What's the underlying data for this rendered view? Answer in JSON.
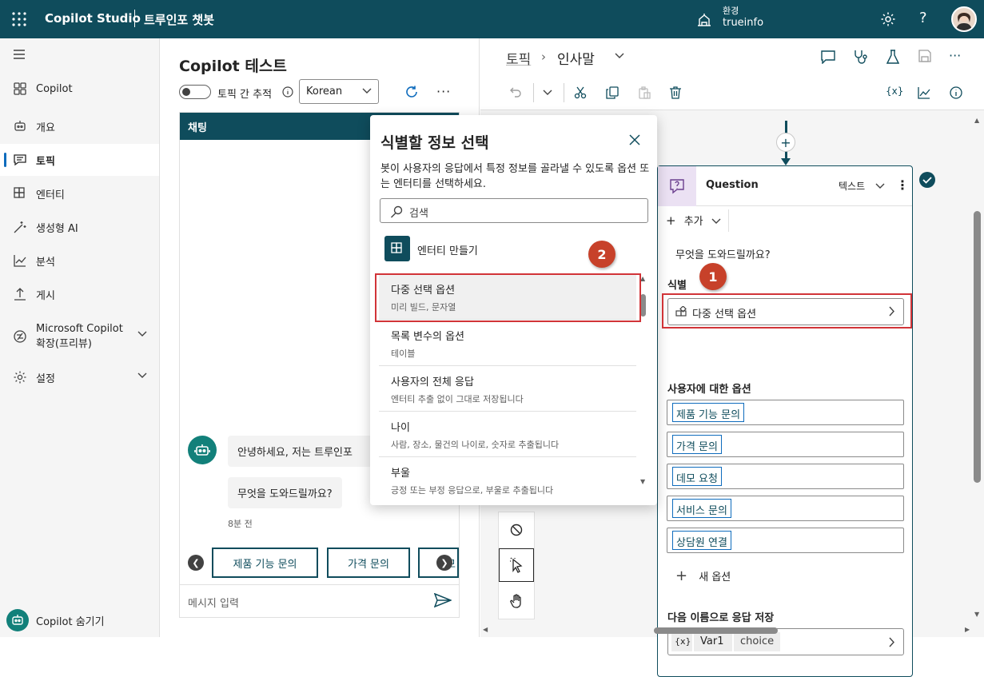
{
  "app": {
    "name": "Copilot Studio",
    "bot_name": "트루인포 챗봇"
  },
  "env": {
    "label": "환경",
    "value": "trueinfo"
  },
  "icons": {
    "waffle": "waffle-icon",
    "env": "environment-icon",
    "settings": "gear-icon",
    "help": "help-icon"
  },
  "sidebar": {
    "items": [
      {
        "label": "Copilot",
        "icon": "copilot-icon"
      },
      {
        "label": "개요",
        "icon": "overview-icon"
      },
      {
        "label": "토픽",
        "icon": "topic-icon"
      },
      {
        "label": "엔터티",
        "icon": "entity-icon"
      },
      {
        "label": "생성형 AI",
        "icon": "generative-ai-icon"
      },
      {
        "label": "분석",
        "icon": "analytics-icon"
      },
      {
        "label": "게시",
        "icon": "publish-icon"
      },
      {
        "label": "Microsoft Copilot 확장(프리뷰)",
        "icon": "extension-icon"
      },
      {
        "label": "설정",
        "icon": "settings-icon"
      }
    ],
    "hide_copilot": "Copilot 숨기기"
  },
  "test": {
    "title": "Copilot 테스트",
    "track_label": "토픽 간 추적",
    "language": "Korean",
    "chat_tab": "채팅",
    "messages": [
      "안녕하세요, 저는 트루인포",
      "무엇을 도와드릴까요?"
    ],
    "timestamp": "8분 전",
    "quick_replies": [
      "제품 기능 문의",
      "가격 문의",
      "데모"
    ],
    "input_placeholder": "메시지 입력"
  },
  "canvas": {
    "breadcrumb_root": "토픽",
    "breadcrumb_current": "인사말",
    "node": {
      "title": "Question",
      "type": "텍스트",
      "add_label": "추가",
      "question_text": "무엇을 도와드릴까요?",
      "identify_label": "식별",
      "identify_value": "다중 선택 옵션",
      "options_label": "사용자에 대한 옵션",
      "options": [
        "제품 기능 문의",
        "가격 문의",
        "데모 요청",
        "서비스 문의",
        "상담원 연결"
      ],
      "new_option": "새 옵션",
      "save_label": "다음 이름으로 응답 저장",
      "var_badge": "{x}",
      "var_name": "Var1",
      "var_type": "choice"
    }
  },
  "dialog": {
    "title": "식별할 정보 선택",
    "description": "봇이 사용자의 응답에서 특정 정보를 골라낼 수 있도록 옵션 또는 엔터티를 선택하세요.",
    "search_placeholder": "검색",
    "create_entity": "엔터티 만들기",
    "items": [
      {
        "title": "다중 선택 옵션",
        "subtitle": "미리 빌드, 문자열"
      },
      {
        "title": "목록 변수의 옵션",
        "subtitle": "테이블"
      },
      {
        "title": "사용자의 전체 응답",
        "subtitle": "엔터티 추출 없이 그대로 저장됩니다"
      },
      {
        "title": "나이",
        "subtitle": "사람, 장소, 물건의 나이로, 숫자로 추출됩니다"
      },
      {
        "title": "부울",
        "subtitle": "긍정 또는 부정 응답으로, 부울로 추출됩니다"
      }
    ]
  },
  "annotations": {
    "badge1": "1",
    "badge2": "2"
  },
  "colors": {
    "header": "#0f4c5c",
    "accent": "#0f6cbd",
    "annotation": "#d13438",
    "badge": "#c7412a"
  }
}
